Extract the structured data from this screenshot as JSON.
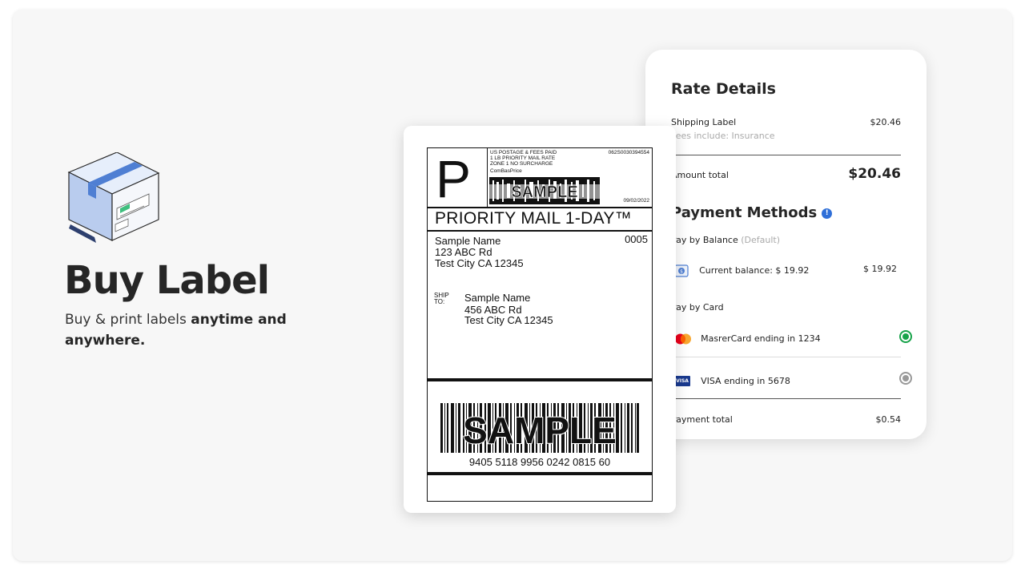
{
  "hero": {
    "title": "Buy Label",
    "subtitle_plain": "Buy & print labels ",
    "subtitle_bold": "anytime and anywhere."
  },
  "label": {
    "service_letter": "P",
    "postage_lines": [
      "US POSTAGE & FEES PAID",
      "1 LB PRIORITY MAIL RATE",
      "ZONE 1 NO SURCHARGE",
      "ComBasPrice"
    ],
    "tracking_code": "062S0030394554",
    "date": "09/02/2022",
    "sample_text": "SAMPLE",
    "product": "PRIORITY MAIL 1-DAY™",
    "from": {
      "name": "Sample Name",
      "street": "123 ABC Rd",
      "city": "Test City CA 12345"
    },
    "route_code": "0005",
    "ship_to_label": "SHIP TO:",
    "to": {
      "name": "Sample Name",
      "street": "456 ABC Rd",
      "city": "Test City CA 12345"
    },
    "barcode_number": "9405 5118 9956 0242 0815 60"
  },
  "rate_details": {
    "title": "Rate Details",
    "shipping_label": "Shipping Label",
    "shipping_amount": "$20.46",
    "fees_note": "Fees include: Insurance",
    "amount_total_label": "Amount total",
    "amount_total": "$20.46"
  },
  "payment": {
    "title": "Payment Methods",
    "pay_by_balance": "Pay by Balance",
    "default_tag": "(Default)",
    "current_balance_label": "Current balance: $ 19.92",
    "current_balance_amount": "$ 19.92",
    "pay_by_card": "Pay by Card",
    "cards": [
      {
        "label": "MasrerCard ending in 1234",
        "selected": true
      },
      {
        "label": "VISA ending in 5678",
        "selected": false
      }
    ],
    "visa_badge": "VISA",
    "payment_total_label": "Payment total",
    "payment_total": "$0.54"
  },
  "colors": {
    "accent_blue": "#2f6fd8",
    "selected_green": "#17a34a",
    "box_light": "#cfdcf2",
    "box_stripe": "#4f7fd3"
  }
}
